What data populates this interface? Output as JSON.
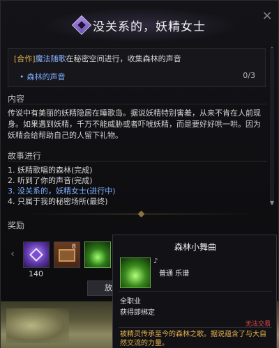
{
  "header": {
    "title": "没关系的，妖精女士"
  },
  "objective": {
    "tag": "[合作]",
    "link": "魔法随歌",
    "text": "在秘密空间进行，收集森林的声音",
    "sub_label": "森林的声音",
    "progress": "0/3"
  },
  "content": {
    "section_title": "内容",
    "text": "传说中有美丽的妖精隐居在睡歌岛。据说妖精特别害羞，从来不肯在人前现身。如果遇到妖精，千万不能威胁或者吓唬妖精，而是要好好哄一哄。因为妖精会给帮助自己的人留下礼物。"
  },
  "story": {
    "section_title": "故事进行",
    "items": [
      "1. 妖精歌唱的森林(完成)",
      "2. 听到了你的声音(完成)",
      "3. 没关系的，妖精女士(进行中)",
      "4. 只属于我的秘密场所(最终)"
    ]
  },
  "rewards": {
    "section_title": "奖励",
    "count_a": "140",
    "count_b": "8",
    "button_partial": "放"
  },
  "tooltip": {
    "title": "森林小舞曲",
    "type": "普通 乐谱",
    "class": "全职业",
    "bind": "获得即绑定",
    "trade": "无法交易",
    "desc": "被精灵传承至今的森林之歌。据说蕴含了与大自然交流的力量。"
  },
  "colors": {
    "accent_purple": "#6a4fb3",
    "link_blue": "#7fb0ff",
    "gold": "#e3b04b",
    "warning_red": "#e04a4a"
  }
}
